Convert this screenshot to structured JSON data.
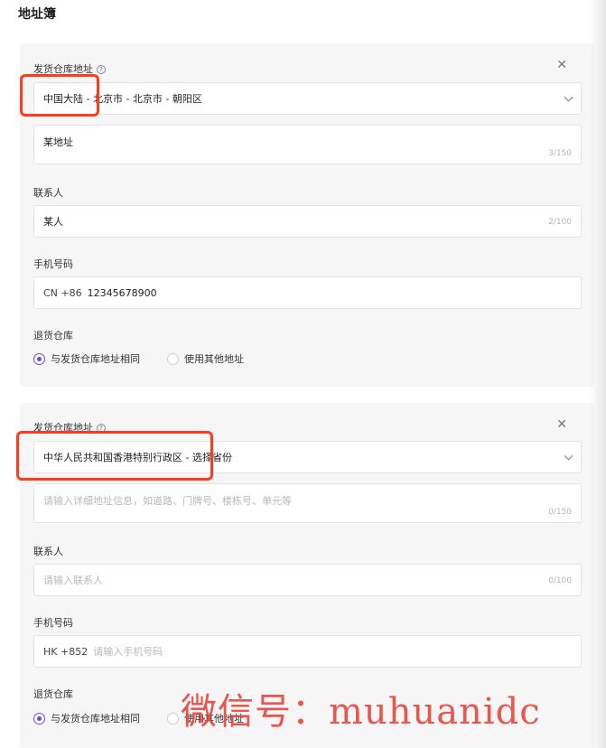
{
  "page": {
    "title": "地址簿"
  },
  "cards": [
    {
      "warehouse_label": "发货仓库地址",
      "region_value": "中国大陆 - 北京市 - 北京市 - 朝阳区",
      "address_value": "某地址",
      "address_counter": "3/150",
      "contact_label": "联系人",
      "contact_value": "某人",
      "contact_counter": "2/100",
      "phone_label": "手机号码",
      "phone_prefix": "CN +86",
      "phone_value": "12345678900",
      "return_label": "退货仓库",
      "return_options": [
        "与发货仓库地址相同",
        "使用其他地址"
      ],
      "return_selected": 0
    },
    {
      "warehouse_label": "发货仓库地址",
      "region_value": "中华人民共和国香港特别行政区 - 选择省份",
      "address_placeholder": "请输入详细地址信息，如道路、门牌号、楼栋号、单元等",
      "address_counter": "0/150",
      "contact_label": "联系人",
      "contact_placeholder": "请输入联系人",
      "contact_counter": "0/100",
      "phone_label": "手机号码",
      "phone_prefix": "HK +852",
      "phone_placeholder": "请输入手机号码",
      "return_label": "退货仓库",
      "return_options": [
        "与发货仓库地址相同",
        "使用其他地址"
      ],
      "return_selected": 0
    }
  ],
  "watermark": "微信号：muhuanidc",
  "colors": {
    "accent": "#5a4fe0",
    "highlight": "#ff3b1f",
    "watermark": "#e6463c"
  }
}
